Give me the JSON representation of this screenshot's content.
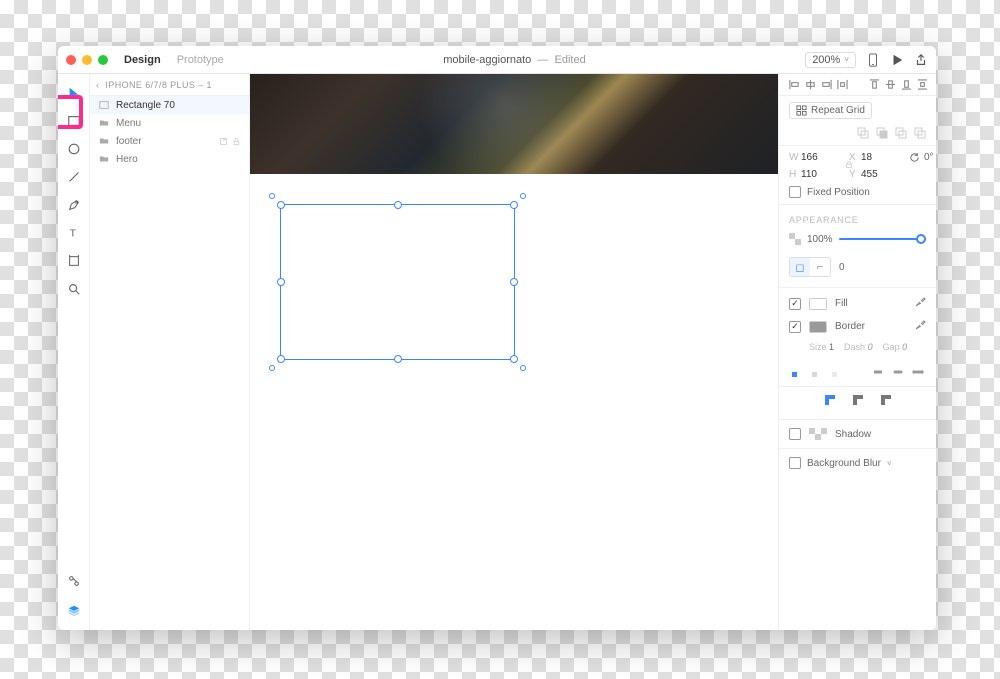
{
  "title": {
    "filename": "mobile-aggiornato",
    "status": "Edited"
  },
  "modes": {
    "design": "Design",
    "prototype": "Prototype"
  },
  "zoom": "200%",
  "breadcrumb": "IPHONE 6/7/8 PLUS – 1",
  "layers": {
    "items": [
      {
        "name": "Rectangle 70",
        "type": "rect",
        "selected": true
      },
      {
        "name": "Menu",
        "type": "folder"
      },
      {
        "name": "footer",
        "type": "folder",
        "extras": true
      },
      {
        "name": "Hero",
        "type": "folder"
      }
    ]
  },
  "inspector": {
    "repeat_grid": "Repeat Grid",
    "dims": {
      "w": "166",
      "h": "110",
      "x": "18",
      "y": "455",
      "rot": "0°"
    },
    "fixed_position": "Fixed Position",
    "section_appearance": "APPEARANCE",
    "opacity": "100%",
    "corner_radius": "0",
    "fill_label": "Fill",
    "border_label": "Border",
    "stroke": {
      "size_lbl": "Size",
      "size": "1",
      "dash_lbl": "Dash",
      "dash": "0",
      "gap_lbl": "Gap",
      "gap": "0"
    },
    "shadow_label": "Shadow",
    "bgblur_label": "Background Blur"
  }
}
